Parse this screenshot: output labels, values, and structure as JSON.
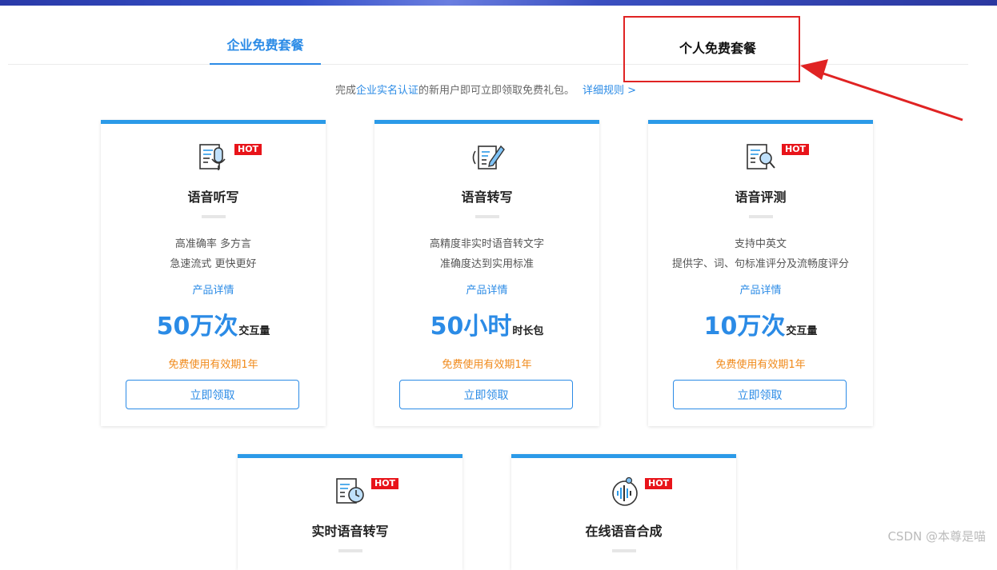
{
  "tabs": {
    "enterprise": "企业免费套餐",
    "personal": "个人免费套餐"
  },
  "notice": {
    "prefix": "完成",
    "link": "企业实名认证",
    "suffix": "的新用户即可立即领取免费礼包。",
    "rules": "详细规则 >"
  },
  "hot_badge": "HOT",
  "cards": [
    {
      "title": "语音听写",
      "desc1": "高准确率 多方言",
      "desc2": "急速流式 更快更好",
      "detail": "产品详情",
      "num": "50万次",
      "unit": "交互量",
      "validity": "免费使用有效期1年",
      "button": "立即领取",
      "icon": "microphone-doc-icon",
      "hot": true
    },
    {
      "title": "语音转写",
      "desc1": "高精度非实时语音转文字",
      "desc2": "准确度达到实用标准",
      "detail": "产品详情",
      "num": "50小时",
      "unit": "时长包",
      "validity": "免费使用有效期1年",
      "button": "立即领取",
      "icon": "pen-doc-icon",
      "hot": false
    },
    {
      "title": "语音评测",
      "desc1": "支持中英文",
      "desc2": "提供字、词、句标准评分及流畅度评分",
      "detail": "产品详情",
      "num": "10万次",
      "unit": "交互量",
      "validity": "免费使用有效期1年",
      "button": "立即领取",
      "icon": "magnifier-doc-icon",
      "hot": true
    },
    {
      "title": "实时语音转写",
      "icon": "clock-doc-icon",
      "hot": true
    },
    {
      "title": "在线语音合成",
      "icon": "soundwave-icon",
      "hot": true
    }
  ],
  "watermark": "CSDN @本尊是喵",
  "colors": {
    "accent": "#2b8be6",
    "card_top": "#2b9ae8",
    "hot_badge": "#e8141a",
    "validity": "#f08a1b",
    "highlight": "#e02323"
  }
}
